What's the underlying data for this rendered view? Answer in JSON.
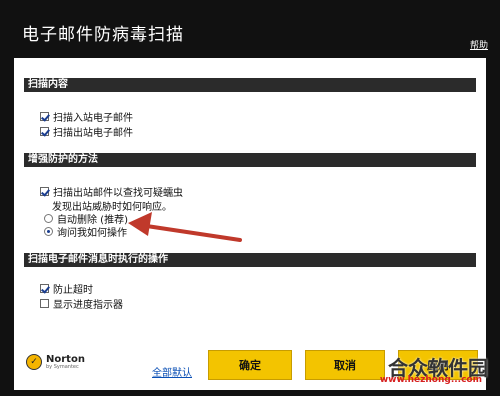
{
  "window": {
    "title": "电子邮件防病毒扫描",
    "help_label": "帮助"
  },
  "sections": {
    "scan_content": {
      "header": "扫描内容",
      "items": [
        {
          "label": "扫描入站电子邮件",
          "checked": true
        },
        {
          "label": "扫描出站电子邮件",
          "checked": true
        }
      ]
    },
    "enhanced_protection": {
      "header": "增强防护的方法",
      "worm_scan": {
        "label": "扫描出站邮件以查找可疑蠕虫",
        "checked": true
      },
      "threat_prompt": "发现出站威胁时如何响应。",
      "options": [
        {
          "label": "自动删除 (推荐)",
          "selected": false
        },
        {
          "label": "询问我如何操作",
          "selected": true
        }
      ]
    },
    "scan_actions": {
      "header": "扫描电子邮件消息时执行的操作",
      "items": [
        {
          "label": "防止超时",
          "checked": true
        },
        {
          "label": "显示进度指示器",
          "checked": false
        }
      ]
    }
  },
  "footer": {
    "logo_name": "Norton",
    "logo_sub": "by Symantec",
    "defaults_link": "全部默认",
    "ok_label": "确定",
    "cancel_label": "取消",
    "apply_label": "应用"
  },
  "watermark": {
    "text": "合众软件园",
    "url": "www.hezhong...com"
  },
  "colors": {
    "window_bg": "#111111",
    "section_bg": "#2b2b2b",
    "button_yellow": "#f3c400",
    "link_blue": "#0a4fb5",
    "arrow_red": "#c0392b"
  }
}
